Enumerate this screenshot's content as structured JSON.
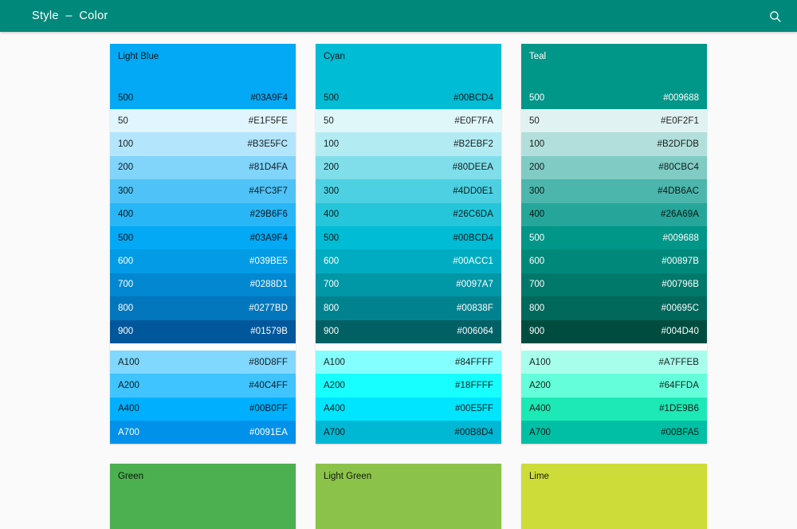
{
  "appbar": {
    "title": "Style  –  Color",
    "search_icon": "search-icon"
  },
  "palettes": [
    {
      "name": "Light Blue",
      "header": {
        "label": "500",
        "hex": "#03A9F4",
        "bg": "#03A9F4",
        "text": "dark"
      },
      "rows": [
        {
          "label": "50",
          "hex": "#E1F5FE",
          "text": "dark"
        },
        {
          "label": "100",
          "hex": "#B3E5FC",
          "text": "dark"
        },
        {
          "label": "200",
          "hex": "#81D4FA",
          "text": "dark"
        },
        {
          "label": "300",
          "hex": "#4FC3F7",
          "text": "dark"
        },
        {
          "label": "400",
          "hex": "#29B6F6",
          "text": "dark"
        },
        {
          "label": "500",
          "hex": "#03A9F4",
          "text": "dark"
        },
        {
          "label": "600",
          "hex": "#039BE5",
          "text": "light"
        },
        {
          "label": "700",
          "hex": "#0288D1",
          "text": "light"
        },
        {
          "label": "800",
          "hex": "#0277BD",
          "text": "light"
        },
        {
          "label": "900",
          "hex": "#01579B",
          "text": "light"
        }
      ],
      "accents": [
        {
          "label": "A100",
          "hex": "#80D8FF",
          "text": "dark"
        },
        {
          "label": "A200",
          "hex": "#40C4FF",
          "text": "dark"
        },
        {
          "label": "A400",
          "hex": "#00B0FF",
          "text": "dark"
        },
        {
          "label": "A700",
          "hex": "#0091EA",
          "text": "light"
        }
      ]
    },
    {
      "name": "Cyan",
      "header": {
        "label": "500",
        "hex": "#00BCD4",
        "bg": "#00BCD4",
        "text": "dark"
      },
      "rows": [
        {
          "label": "50",
          "hex": "#E0F7FA",
          "text": "dark"
        },
        {
          "label": "100",
          "hex": "#B2EBF2",
          "text": "dark"
        },
        {
          "label": "200",
          "hex": "#80DEEA",
          "text": "dark"
        },
        {
          "label": "300",
          "hex": "#4DD0E1",
          "text": "dark"
        },
        {
          "label": "400",
          "hex": "#26C6DA",
          "text": "dark"
        },
        {
          "label": "500",
          "hex": "#00BCD4",
          "text": "dark"
        },
        {
          "label": "600",
          "hex": "#00ACC1",
          "text": "light"
        },
        {
          "label": "700",
          "hex": "#0097A7",
          "text": "light"
        },
        {
          "label": "800",
          "hex": "#00838F",
          "text": "light"
        },
        {
          "label": "900",
          "hex": "#006064",
          "text": "light"
        }
      ],
      "accents": [
        {
          "label": "A100",
          "hex": "#84FFFF",
          "text": "dark"
        },
        {
          "label": "A200",
          "hex": "#18FFFF",
          "text": "dark"
        },
        {
          "label": "A400",
          "hex": "#00E5FF",
          "text": "dark"
        },
        {
          "label": "A700",
          "hex": "#00B8D4",
          "text": "dark"
        }
      ]
    },
    {
      "name": "Teal",
      "header": {
        "label": "500",
        "hex": "#009688",
        "bg": "#009688",
        "text": "light"
      },
      "rows": [
        {
          "label": "50",
          "hex": "#E0F2F1",
          "text": "dark"
        },
        {
          "label": "100",
          "hex": "#B2DFDB",
          "text": "dark"
        },
        {
          "label": "200",
          "hex": "#80CBC4",
          "text": "dark"
        },
        {
          "label": "300",
          "hex": "#4DB6AC",
          "text": "dark"
        },
        {
          "label": "400",
          "hex": "#26A69A",
          "text": "dark"
        },
        {
          "label": "500",
          "hex": "#009688",
          "text": "light"
        },
        {
          "label": "600",
          "hex": "#00897B",
          "text": "light"
        },
        {
          "label": "700",
          "hex": "#00796B",
          "text": "light"
        },
        {
          "label": "800",
          "hex": "#00695C",
          "text": "light"
        },
        {
          "label": "900",
          "hex": "#004D40",
          "text": "light"
        }
      ],
      "accents": [
        {
          "label": "A100",
          "hex": "#A7FFEB",
          "text": "dark"
        },
        {
          "label": "A200",
          "hex": "#64FFDA",
          "text": "dark"
        },
        {
          "label": "A400",
          "hex": "#1DE9B6",
          "text": "dark"
        },
        {
          "label": "A700",
          "hex": "#00BFA5",
          "text": "dark"
        }
      ]
    },
    {
      "name": "Green",
      "header": {
        "label": "",
        "hex": "",
        "bg": "#4CAF50",
        "text": "dark"
      },
      "rows": [],
      "accents": []
    },
    {
      "name": "Light Green",
      "header": {
        "label": "",
        "hex": "",
        "bg": "#8BC34A",
        "text": "dark"
      },
      "rows": [],
      "accents": []
    },
    {
      "name": "Lime",
      "header": {
        "label": "",
        "hex": "",
        "bg": "#CDDC39",
        "text": "dark"
      },
      "rows": [],
      "accents": []
    }
  ]
}
